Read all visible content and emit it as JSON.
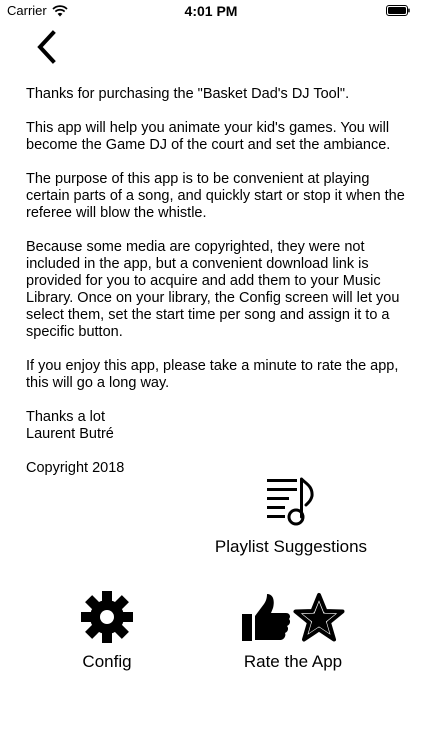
{
  "status_bar": {
    "carrier": "Carrier",
    "time": "4:01 PM"
  },
  "body": {
    "paragraphs": [
      "Thanks for purchasing the \"Basket Dad's DJ Tool\".",
      "This app will help you animate your kid's games. You will become the Game DJ of the court and set the ambiance.",
      "The purpose of this app is to be convenient at playing certain parts of a song, and quickly start or stop it when the referee will blow the whistle.",
      "Because some media are copyrighted, they were not included in the app, but a convenient download link is provided for you to acquire and add them to your Music Library. Once on your library, the Config screen will let you select them, set the start time per song and assign it to a specific button.",
      "If you enjoy this app, please take a minute to rate the app, this will go a long way.",
      "Thanks a lot",
      "Laurent Butré",
      "Copyright 2018"
    ]
  },
  "actions": {
    "playlist_label": "Playlist Suggestions",
    "config_label": "Config",
    "rate_label": "Rate the App"
  },
  "icons": {
    "back": "chevron-left-icon",
    "playlist": "playlist-music-icon",
    "config": "gear-icon",
    "thumbs_up": "thumbs-up-icon",
    "star": "star-icon"
  }
}
